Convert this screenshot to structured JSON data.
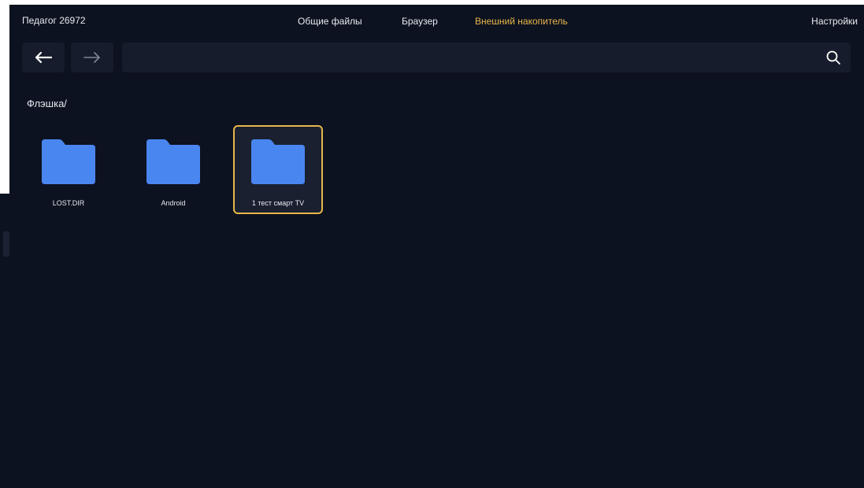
{
  "header": {
    "user": "Педагог 26972",
    "tabs": [
      {
        "label": "Общие файлы",
        "active": false
      },
      {
        "label": "Браузер",
        "active": false
      },
      {
        "label": "Внешний накопитель",
        "active": true
      }
    ],
    "settings": "Настройки"
  },
  "toolbar": {
    "back_icon": "arrow-left-icon",
    "forward_icon": "arrow-right-icon",
    "search_value": "",
    "search_icon": "search-icon"
  },
  "breadcrumb": "Флэшка/",
  "folders": [
    {
      "name": "LOST.DIR",
      "selected": false
    },
    {
      "name": "Android",
      "selected": false
    },
    {
      "name": "1 тест смарт TV",
      "selected": true
    }
  ],
  "colors": {
    "background": "#0d1220",
    "active_tab": "#e7b649",
    "folder": "#4a86f0",
    "selection_border": "#e7b649"
  }
}
